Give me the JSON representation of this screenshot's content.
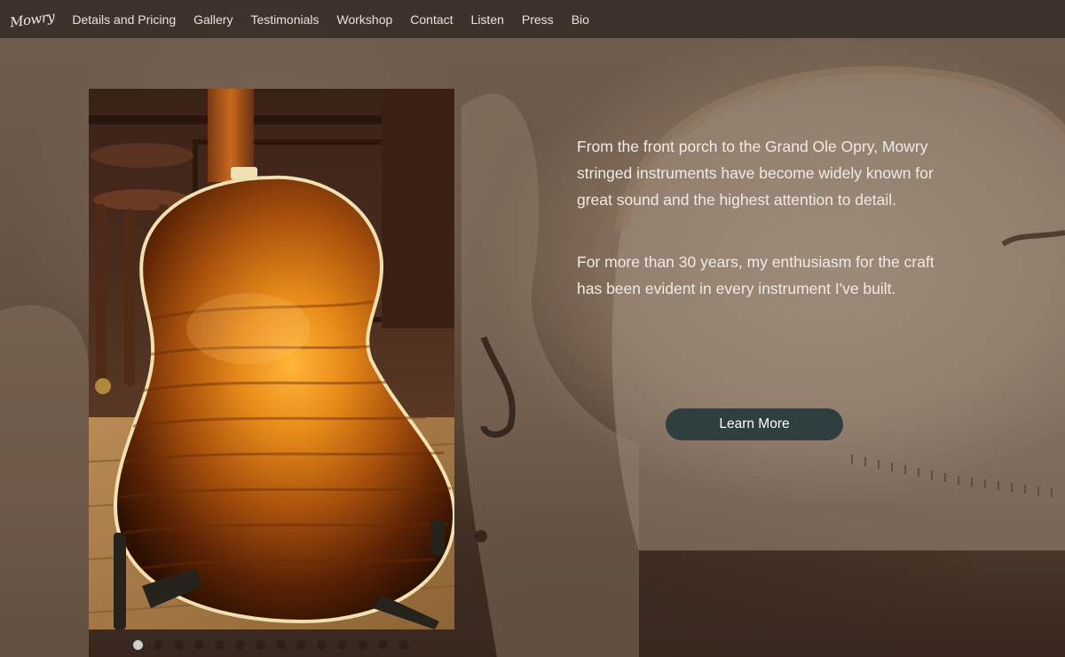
{
  "nav": {
    "logo_text": "Mowry",
    "items": [
      {
        "label": "Details and Pricing"
      },
      {
        "label": "Gallery"
      },
      {
        "label": "Testimonials"
      },
      {
        "label": "Workshop"
      },
      {
        "label": "Contact"
      },
      {
        "label": "Listen"
      },
      {
        "label": "Press"
      },
      {
        "label": "Bio"
      }
    ]
  },
  "hero": {
    "paragraph_1": "From the front porch to the Grand Ole Opry, Mowry stringed instruments have become widely known for great sound and the highest attention to detail.",
    "paragraph_2": "For more than 30 years, my enthusiasm for the craft has been evident in every instrument I've built.",
    "cta_label": "Learn More"
  },
  "carousel": {
    "slide_count": 14,
    "active_index": 0
  },
  "colors": {
    "nav_background": "#30281f",
    "button_background": "#2f3f3f",
    "active_dot": "#cfcfcf"
  }
}
